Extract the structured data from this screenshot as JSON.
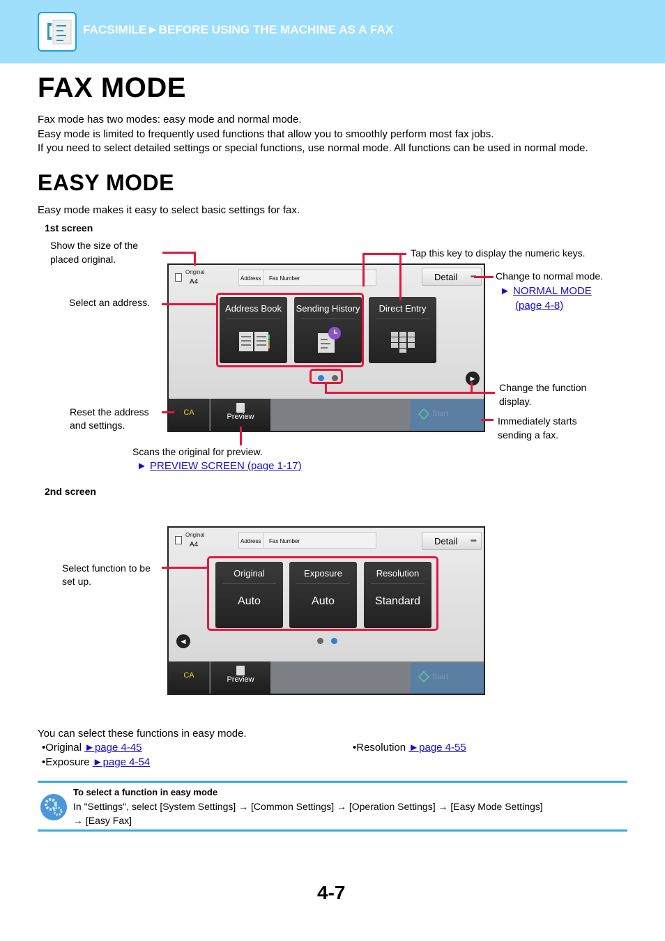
{
  "header": {
    "icon": "fax-icon",
    "breadcrumb": "FACSIMILE►BEFORE USING THE MACHINE AS A FAX"
  },
  "title": "FAX MODE",
  "intro": [
    "Fax mode has two modes: easy mode and normal mode.",
    "Easy mode is limited to frequently used functions that allow you to smoothly perform most fax jobs.",
    "If you need to select detailed settings or special functions, use normal mode. All functions can be used in normal mode."
  ],
  "section_title": "EASY MODE",
  "section_intro": "Easy mode makes it easy to select basic settings for fax.",
  "screen1": {
    "label": "1st screen",
    "original_label": "Original",
    "original_value": "A4",
    "address_label": "Address",
    "address_placeholder": "Fax Number",
    "detail_label": "Detail",
    "tiles": [
      "Address Book",
      "Sending History",
      "Direct Entry"
    ],
    "ca_label": "CA",
    "preview_label": "Preview",
    "start_label": "Start",
    "active_page": 1
  },
  "screen2": {
    "label": "2nd screen",
    "original_label": "Original",
    "original_value": "A4",
    "address_label": "Address",
    "address_placeholder": "Fax Number",
    "detail_label": "Detail",
    "tiles": [
      {
        "title": "Original",
        "value": "Auto"
      },
      {
        "title": "Exposure",
        "value": "Auto"
      },
      {
        "title": "Resolution",
        "value": "Standard"
      }
    ],
    "ca_label": "CA",
    "preview_label": "Preview",
    "start_label": "Start",
    "active_page": 2
  },
  "annotations": {
    "size": "Show the size of the placed original.",
    "address": "Select an address.",
    "reset": "Reset the address and settings.",
    "scan": "Scans the original for preview.",
    "preview_link": "PREVIEW SCREEN (page 1-17)",
    "numeric": "Tap this key to display the numeric keys.",
    "normal": "Change to normal mode.",
    "normal_link_1": "NORMAL MODE ",
    "normal_link_2": "(page 4-8)",
    "function_display": "Change the function display.",
    "start": "Immediately starts sending a fax.",
    "select_function": "Select function to be set up."
  },
  "functions": {
    "intro": "You can select these functions in easy mode.",
    "items": [
      {
        "label": "•Original ",
        "link": "►page 4-45"
      },
      {
        "label": "•Resolution ",
        "link": "►page 4-55"
      },
      {
        "label": "•Exposure ",
        "link": "►page 4-54"
      }
    ]
  },
  "tip": {
    "icon": "settings-gear-icon",
    "title": "To select a function in easy mode",
    "line1": "In \"Settings\", select [System Settings] → [Common Settings] → [Operation Settings] → [Easy Mode Settings]",
    "line2": "→ [Easy Fax]"
  },
  "page_number": "4-7",
  "colors": {
    "accent": "#9fdffc",
    "callout": "#e4163a",
    "rule": "#37a8e6",
    "link": "#1a0dcc"
  }
}
